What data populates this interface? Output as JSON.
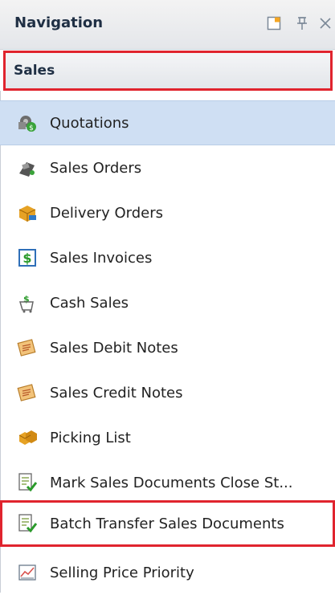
{
  "header": {
    "title": "Navigation"
  },
  "section": {
    "label": "Sales"
  },
  "items": [
    {
      "label": "Quotations",
      "icon": "quotations-icon"
    },
    {
      "label": "Sales Orders",
      "icon": "sales-orders-icon"
    },
    {
      "label": "Delivery Orders",
      "icon": "delivery-orders-icon"
    },
    {
      "label": "Sales Invoices",
      "icon": "sales-invoices-icon"
    },
    {
      "label": "Cash Sales",
      "icon": "cash-sales-icon"
    },
    {
      "label": "Sales Debit Notes",
      "icon": "debit-notes-icon"
    },
    {
      "label": "Sales Credit Notes",
      "icon": "credit-notes-icon"
    },
    {
      "label": "Picking List",
      "icon": "picking-list-icon"
    },
    {
      "label": "Mark Sales Documents Close St...",
      "icon": "mark-close-icon"
    },
    {
      "label": "Batch Transfer Sales Documents",
      "icon": "batch-transfer-icon"
    },
    {
      "label": "Selling Price Priority",
      "icon": "selling-price-icon"
    }
  ],
  "colors": {
    "selected": "#cfdff3",
    "highlight_border": "#e0242e"
  }
}
